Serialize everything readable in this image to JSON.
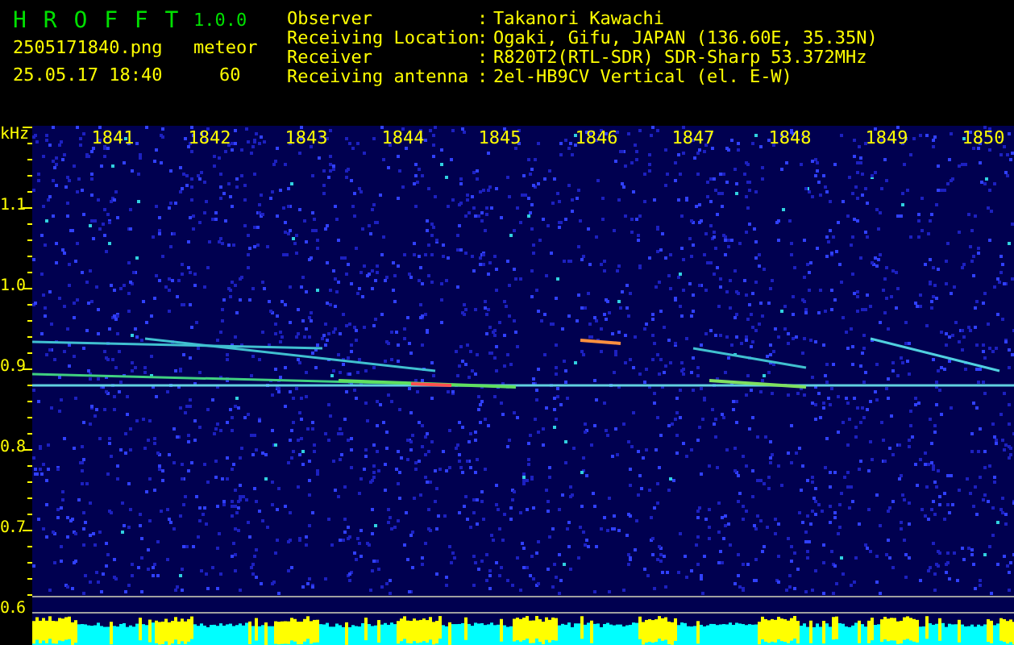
{
  "header": {
    "app_name": "H R O F F T",
    "version": "1.0.0",
    "filename": "2505171840.png",
    "mode": "meteor",
    "datetime": "25.05.17 18:40",
    "count": "60"
  },
  "info": [
    {
      "label": "Observer",
      "separator": ":",
      "value": "Takanori Kawachi"
    },
    {
      "label": "Receiving Location",
      "separator": ":",
      "value": "Ogaki, Gifu, JAPAN (136.60E, 35.35N)"
    },
    {
      "label": "Receiver",
      "separator": ":",
      "value": "R820T2(RTL-SDR) SDR-Sharp 53.372MHz"
    },
    {
      "label": "Receiving antenna",
      "separator": ":",
      "value": "2el-HB9CV Vertical (el. E-W)"
    }
  ],
  "plot": {
    "unit_label": "kHz",
    "time_labels": [
      "1841",
      "1842",
      "1843",
      "1844",
      "1845",
      "1846",
      "1847",
      "1848",
      "1849",
      "1850"
    ],
    "frequency_labels": [
      "1.1",
      "1.0",
      "0.9",
      "0.8",
      "0.7",
      "0.6"
    ]
  }
}
